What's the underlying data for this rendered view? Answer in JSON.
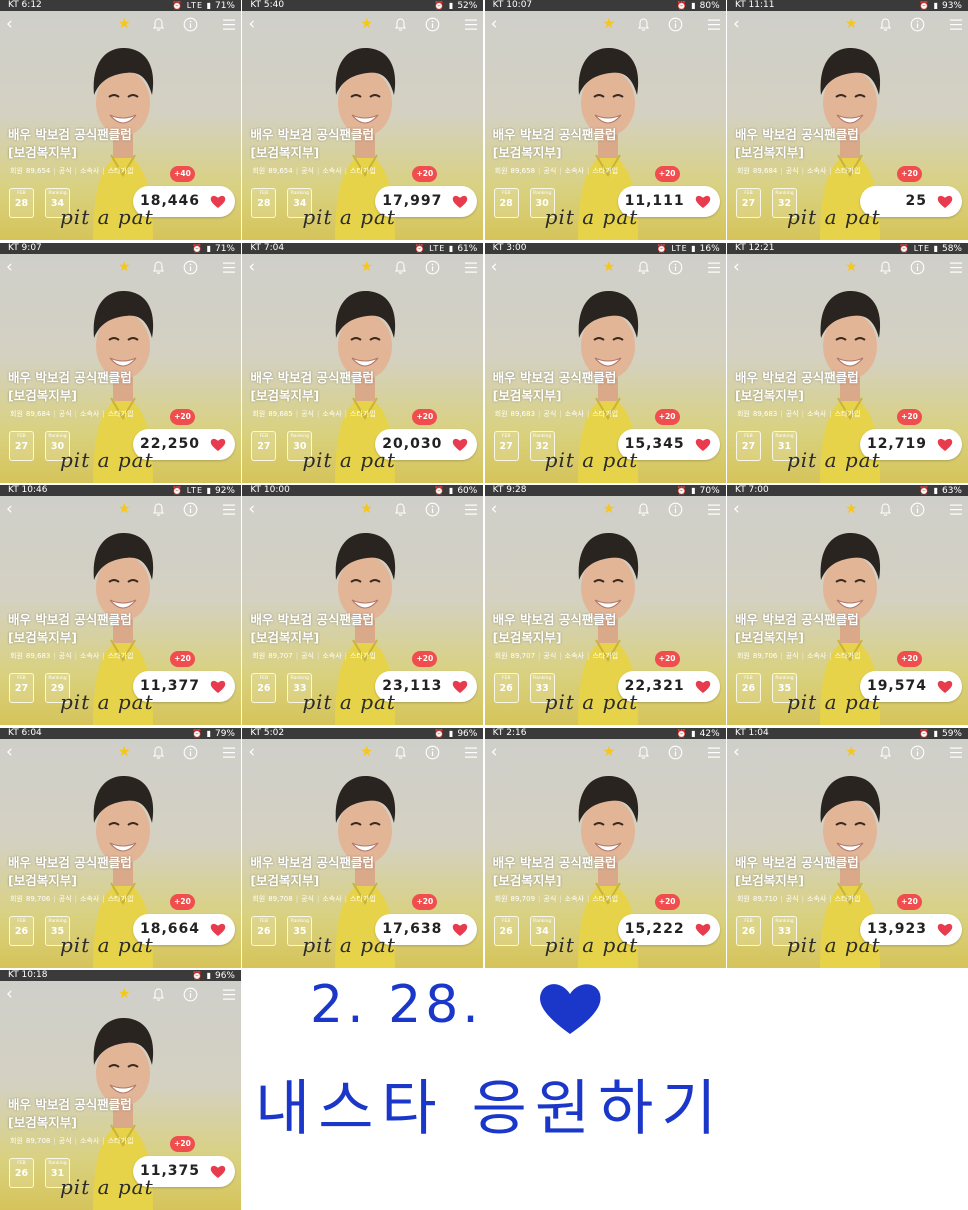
{
  "app": {
    "title": "배우 박보검 공식팬클럽",
    "subtitle": "[보검복지부]",
    "meta": {
      "members_label": "회원",
      "official_label": "공식",
      "agency_label": "소속사",
      "star_join_label": "스타가입"
    },
    "box_labels": {
      "month": "FEB",
      "ranking": "Ranking"
    },
    "watermark": "pit a pat",
    "colors": {
      "accent_red": "#f04e4e",
      "star": "#f6c61c",
      "handwriting_blue": "#1a37c9"
    }
  },
  "screenshots": [
    {
      "carrier": "KT 6:12",
      "icons": "⏰ LTE ▮",
      "battery": "71%",
      "members": "89,654",
      "bonus": "+40",
      "feb": "28",
      "ranking": "34",
      "votes": "18,446"
    },
    {
      "carrier": "KT 5:40",
      "icons": "⏰ ▮",
      "battery": "52%",
      "members": "89,654",
      "bonus": "+20",
      "feb": "28",
      "ranking": "34",
      "votes": "17,997"
    },
    {
      "carrier": "KT 10:07",
      "icons": "⏰ ▮",
      "battery": "80%",
      "members": "89,658",
      "bonus": "+20",
      "feb": "28",
      "ranking": "30",
      "votes": "11,111"
    },
    {
      "carrier": "KT 11:11",
      "icons": "⏰ ▮",
      "battery": "93%",
      "members": "89,684",
      "bonus": "+20",
      "feb": "27",
      "ranking": "32",
      "votes": "25"
    },
    {
      "carrier": "KT 9:07",
      "icons": "⏰ ▮",
      "battery": "71%",
      "members": "89,684",
      "bonus": "+20",
      "feb": "27",
      "ranking": "30",
      "votes": "22,250"
    },
    {
      "carrier": "KT 7:04",
      "icons": "⏰ LTE ▮",
      "battery": "61%",
      "members": "89,685",
      "bonus": "+20",
      "feb": "27",
      "ranking": "30",
      "votes": "20,030"
    },
    {
      "carrier": "KT 3:00",
      "icons": "⏰ LTE ▮",
      "battery": "16%",
      "members": "89,683",
      "bonus": "+20",
      "feb": "27",
      "ranking": "32",
      "votes": "15,345"
    },
    {
      "carrier": "KT 12:21",
      "icons": "⏰ LTE ▮",
      "battery": "58%",
      "members": "89,683",
      "bonus": "+20",
      "feb": "27",
      "ranking": "31",
      "votes": "12,719"
    },
    {
      "carrier": "KT 10:46",
      "icons": "⏰ LTE ▮",
      "battery": "92%",
      "members": "89,683",
      "bonus": "+20",
      "feb": "27",
      "ranking": "29",
      "votes": "11,377"
    },
    {
      "carrier": "KT 10:00",
      "icons": "⏰ ▮",
      "battery": "60%",
      "members": "89,707",
      "bonus": "+20",
      "feb": "26",
      "ranking": "33",
      "votes": "23,113"
    },
    {
      "carrier": "KT 9:28",
      "icons": "⏰ ▮",
      "battery": "70%",
      "members": "89,707",
      "bonus": "+20",
      "feb": "26",
      "ranking": "33",
      "votes": "22,321"
    },
    {
      "carrier": "KT 7:00",
      "icons": "⏰ ▮",
      "battery": "63%",
      "members": "89,706",
      "bonus": "+20",
      "feb": "26",
      "ranking": "35",
      "votes": "19,574"
    },
    {
      "carrier": "KT 6:04",
      "icons": "⏰ ▮",
      "battery": "79%",
      "members": "89,706",
      "bonus": "+20",
      "feb": "26",
      "ranking": "35",
      "votes": "18,664"
    },
    {
      "carrier": "KT 5:02",
      "icons": "⏰ ▮",
      "battery": "96%",
      "members": "89,708",
      "bonus": "+20",
      "feb": "26",
      "ranking": "35",
      "votes": "17,638"
    },
    {
      "carrier": "KT 2:16",
      "icons": "⏰ ▮",
      "battery": "42%",
      "members": "89,709",
      "bonus": "+20",
      "feb": "26",
      "ranking": "34",
      "votes": "15,222"
    },
    {
      "carrier": "KT 1:04",
      "icons": "⏰ ▮",
      "battery": "59%",
      "members": "89,710",
      "bonus": "+20",
      "feb": "26",
      "ranking": "33",
      "votes": "13,923"
    },
    {
      "carrier": "KT 10:18",
      "icons": "⏰ ▮",
      "battery": "96%",
      "members": "89,708",
      "bonus": "+20",
      "feb": "26",
      "ranking": "31",
      "votes": "11,375"
    }
  ],
  "caption": {
    "date": "2. 28.",
    "message": "내스타 응원하기"
  }
}
